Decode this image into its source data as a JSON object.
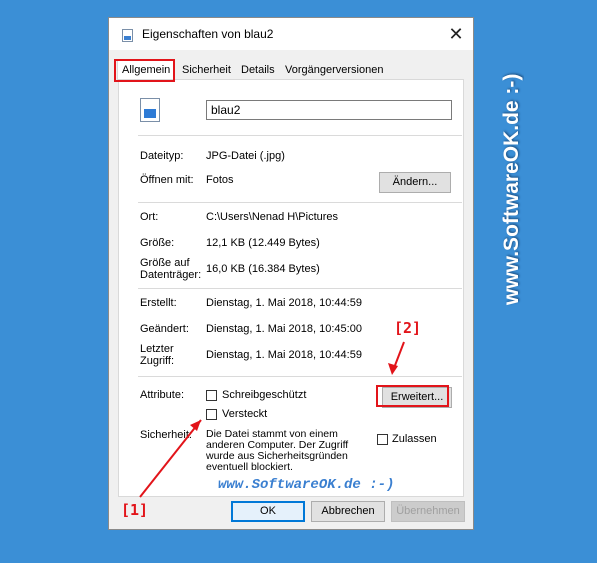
{
  "window": {
    "title": "Eigenschaften von blau2"
  },
  "tabs": [
    "Allgemein",
    "Sicherheit",
    "Details",
    "Vorgängerversionen"
  ],
  "file": {
    "name": "blau2"
  },
  "fields": {
    "dateityp_label": "Dateityp:",
    "dateityp_value": "JPG-Datei (.jpg)",
    "oeffnen_label": "Öffnen mit:",
    "oeffnen_value": "Fotos",
    "aendern_button": "Ändern...",
    "ort_label": "Ort:",
    "ort_value": "C:\\Users\\Nenad H\\Pictures",
    "groesse_label": "Größe:",
    "groesse_value": "12,1 KB (12.449 Bytes)",
    "groesse_auf_label_1": "Größe auf",
    "groesse_auf_label_2": "Datenträger:",
    "groesse_auf_value": "16,0 KB (16.384 Bytes)",
    "erstellt_label": "Erstellt:",
    "erstellt_value": "Dienstag, 1. Mai 2018, 10:44:59",
    "geaendert_label": "Geändert:",
    "geaendert_value": "Dienstag, 1. Mai 2018, 10:45:00",
    "zugriff_label_1": "Letzter",
    "zugriff_label_2": "Zugriff:",
    "zugriff_value": "Dienstag, 1. Mai 2018, 10:44:59",
    "attribute_label": "Attribute:",
    "schreibgeschuetzt": "Schreibgeschützt",
    "versteckt": "Versteckt",
    "erweitert_button": "Erweitert...",
    "sicherheit_label": "Sicherheit:",
    "sicherheit_text_1": "Die Datei stammt von einem",
    "sicherheit_text_2": "anderen Computer. Der Zugriff",
    "sicherheit_text_3": "wurde aus Sicherheitsgründen",
    "sicherheit_text_4": "eventuell blockiert.",
    "zulassen": "Zulassen"
  },
  "checkboxes": {
    "schreibgeschuetzt": false,
    "versteckt": false,
    "zulassen": false
  },
  "buttons": {
    "ok": "OK",
    "abbrechen": "Abbrechen",
    "uebernehmen": "Übernehmen"
  },
  "annotations": {
    "one": "[1]",
    "two": "[2]"
  },
  "watermarks": {
    "vertical": "www.SoftwareOK.de :-)",
    "horizontal": "www.SoftwareOK.de :-)"
  },
  "colors": {
    "background": "#3b8fd6",
    "annotation_red": "#e2141a",
    "accent_blue": "#0078d7"
  }
}
